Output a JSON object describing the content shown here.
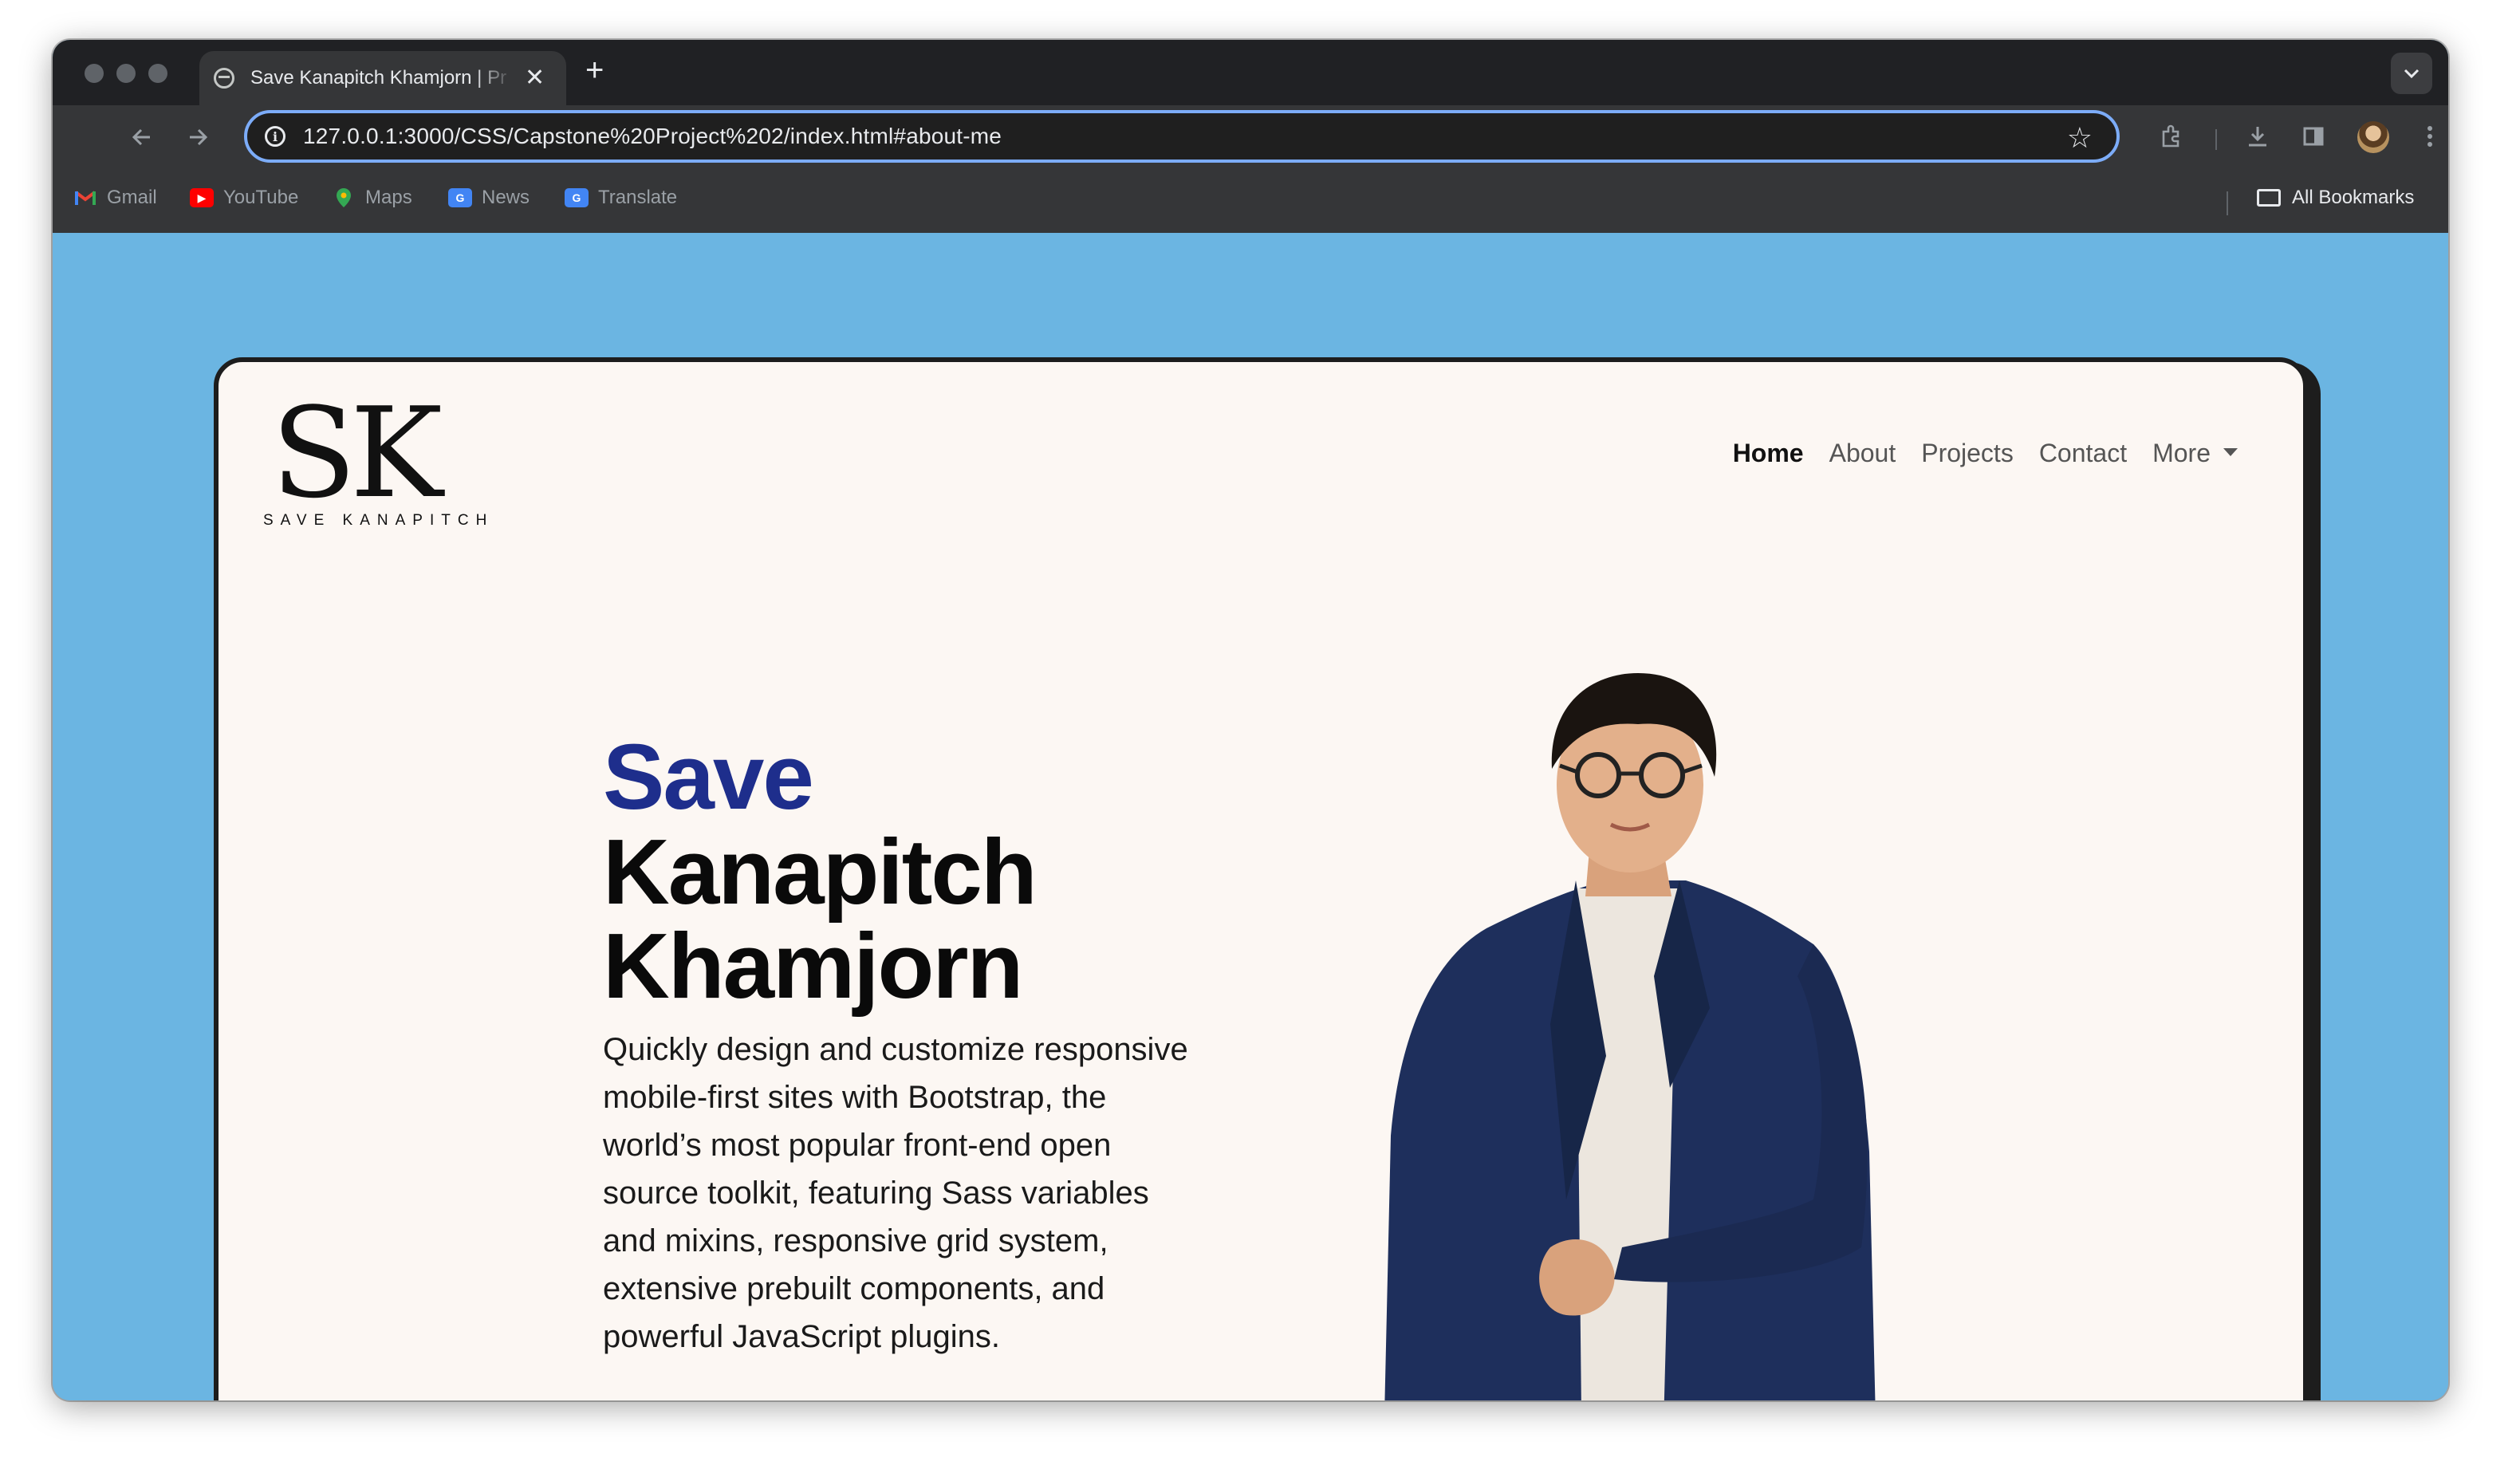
{
  "browser": {
    "tab_title": "Save Kanapitch Khamjorn | Pr",
    "tab_close": "✕",
    "new_tab": "+",
    "url": "127.0.0.1:3000/CSS/Capstone%20Project%202/index.html#about-me",
    "bookmarks": [
      {
        "label": "Gmail",
        "icon": "gmail-icon"
      },
      {
        "label": "YouTube",
        "icon": "youtube-icon"
      },
      {
        "label": "Maps",
        "icon": "maps-icon"
      },
      {
        "label": "News",
        "icon": "news-icon"
      },
      {
        "label": "Translate",
        "icon": "translate-icon"
      }
    ],
    "all_bookmarks": "All Bookmarks",
    "colors": {
      "omnibox_focus": "#7cacf8",
      "chrome_dark": "#202124",
      "toolbar": "#353638"
    }
  },
  "page": {
    "background": "#6bb5e2",
    "logo": {
      "mark": "SK",
      "subtitle": "SAVE KANAPITCH"
    },
    "nav": {
      "items": [
        "Home",
        "About",
        "Projects",
        "Contact"
      ],
      "more": "More",
      "active": "Home"
    },
    "hero": {
      "first_name": "Save",
      "rest_name_line1": "Kanapitch",
      "rest_name_line2": "Khamjorn",
      "description": "Quickly design and customize responsive mobile-first sites with Bootstrap, the world’s most popular front-end open source toolkit, featuring Sass variables and mixins, responsive grid system, extensive prebuilt components, and powerful JavaScript plugins.",
      "accent_color": "#1e2e8c"
    }
  }
}
